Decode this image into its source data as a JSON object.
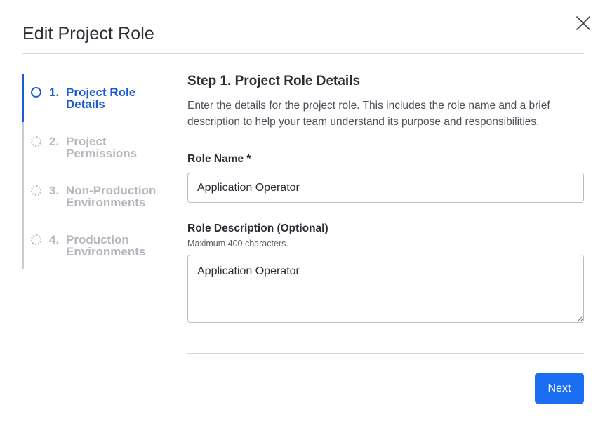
{
  "dialog": {
    "title": "Edit Project Role",
    "close_icon": "close-icon"
  },
  "stepper": {
    "steps": [
      {
        "number": "1.",
        "label": "Project Role Details",
        "state": "active"
      },
      {
        "number": "2.",
        "label": "Project Permissions",
        "state": "inactive"
      },
      {
        "number": "3.",
        "label": "Non-Production Environments",
        "state": "inactive"
      },
      {
        "number": "4.",
        "label": "Production Environments",
        "state": "inactive"
      }
    ]
  },
  "main": {
    "heading": "Step 1. Project Role Details",
    "description": "Enter the details for the project role. This includes the role name and a brief description to help your team understand its purpose and responsibilities.",
    "role_name": {
      "label": "Role Name *",
      "value": "Application Operator"
    },
    "role_description": {
      "label": "Role Description (Optional)",
      "hint": "Maximum 400 characters.",
      "value": "Application Operator"
    },
    "next_label": "Next"
  },
  "colors": {
    "accent": "#1a5bd6",
    "button": "#1a6ef2",
    "inactive": "#b4b8be"
  }
}
